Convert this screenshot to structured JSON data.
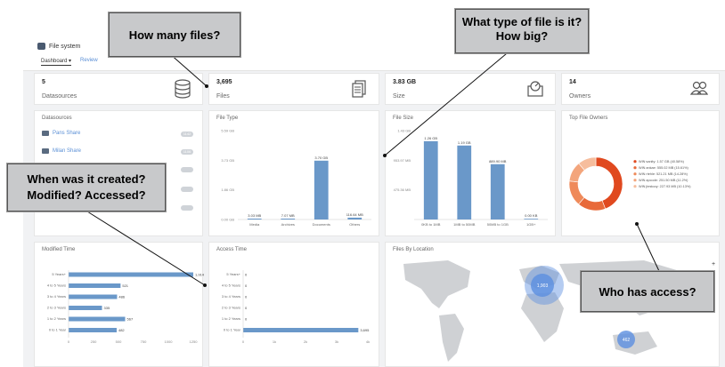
{
  "header": {
    "app_title": "File system",
    "tabs": [
      "Dashboard ▾",
      "Review"
    ]
  },
  "kpis": [
    {
      "value": "5",
      "label": "Datasources",
      "icon": "database-icon"
    },
    {
      "value": "3,695",
      "label": "Files",
      "icon": "files-icon"
    },
    {
      "value": "3.83 GB",
      "label": "Size",
      "icon": "size-icon"
    },
    {
      "value": "14",
      "label": "Owners",
      "icon": "users-icon"
    }
  ],
  "datasources": {
    "title": "Datasources",
    "items": [
      {
        "label": "Pans Share",
        "badge": "1142"
      },
      {
        "label": "Milan Share",
        "badge": "1106"
      }
    ]
  },
  "panels": {
    "file_type": "File Type",
    "file_size": "File Size",
    "top_owners": "Top File Owners",
    "modified_time": "Modified Time",
    "access_time": "Access Time",
    "files_by_location": "Files By Location"
  },
  "colors": {
    "bar": "#6a98c9",
    "donut": [
      "#e0491f",
      "#e86a3a",
      "#ef8a5a",
      "#f3a57c",
      "#f6bd9d"
    ],
    "map_land": "#cfd1d4",
    "bubble": "#5b8fe0"
  },
  "chart_data": [
    {
      "type": "bar",
      "title": "File Type",
      "categories": [
        "Media",
        "Archives",
        "Documents",
        "Others"
      ],
      "values": [
        0.03,
        0.007,
        3.7,
        0.116
      ],
      "data_labels": [
        "3.03 MB",
        "7.07 MB",
        "3.70 GB",
        "116.64 MB"
      ],
      "ytick_labels": [
        "0.00 GB",
        "1.86 GB",
        "3.73 GB",
        "5.59 GB"
      ],
      "ylim": [
        0,
        5.59
      ]
    },
    {
      "type": "bar",
      "title": "File Size",
      "categories": [
        "0KB to 1MB",
        "1MB to 50MB",
        "50MB to 1GB",
        "1GB+"
      ],
      "values": [
        1.26,
        1.19,
        0.89,
        0.0
      ],
      "data_labels": [
        "1.26 GB",
        "1.19 GB",
        "889.90 MB",
        "0.00 KB"
      ],
      "ytick_labels": [
        "475.36 MB",
        "953.97 MB",
        "1.43 GB"
      ],
      "ylim": [
        0,
        1.43
      ]
    },
    {
      "type": "pie",
      "title": "Top File Owners",
      "labels": [
        "WIN sanity",
        "WIN ankae",
        "WIN rtehle",
        "WIN apcode",
        "WIN jtestooy"
      ],
      "values": [
        40.58,
        15.61,
        14.28,
        11.2,
        10.13
      ],
      "legend": [
        "WIN sanity: 1.57 GB (40.58%)",
        "WIN ankae: 555.02 MB (15.61%)",
        "WIN rtehle: 521.21 MB (14.28%)",
        "WIN apcode: 251.50 MB (11.2%)",
        "WIN jtestooy: 227.93 MB (10.13%)"
      ]
    },
    {
      "type": "bar",
      "title": "Modified Time",
      "categories": [
        "5 Years+",
        "4 to 5 Years",
        "3 to 4 Years",
        "2 to 3 Years",
        "1 to 2 Years",
        "0 to 1 Year"
      ],
      "values": [
        1914,
        521,
        486,
        335,
        567,
        482
      ],
      "data_labels": [
        "1,914",
        "521",
        "486",
        "335",
        "567",
        "482"
      ],
      "xticks": [
        0,
        250,
        500,
        750,
        1000,
        1250
      ],
      "xlim": [
        0,
        1250
      ]
    },
    {
      "type": "bar",
      "title": "Access Time",
      "categories": [
        "5 Years+",
        "4 to 5 Years",
        "3 to 4 Years",
        "2 to 3 Years",
        "1 to 2 Years",
        "0 to 1 Year"
      ],
      "values": [
        0,
        0,
        0,
        0,
        0,
        3695
      ],
      "data_labels": [
        "0",
        "0",
        "0",
        "0",
        "0",
        "3,695"
      ],
      "xticks_labels": [
        "0",
        "1k",
        "2k",
        "3k",
        "4k"
      ],
      "xlim": [
        0,
        4000
      ]
    }
  ],
  "map": {
    "bubbles": [
      {
        "label": "1,903",
        "region": "Europe"
      },
      {
        "label": "462",
        "region": "Australia"
      }
    ],
    "zoom_controls": [
      "+",
      "–",
      "+"
    ]
  },
  "callouts": {
    "how_many": "How many files?",
    "what_type": "What type of file is it?  How big?",
    "when_created": "When was it created? Modified? Accessed?",
    "who_access": "Who has access?"
  }
}
